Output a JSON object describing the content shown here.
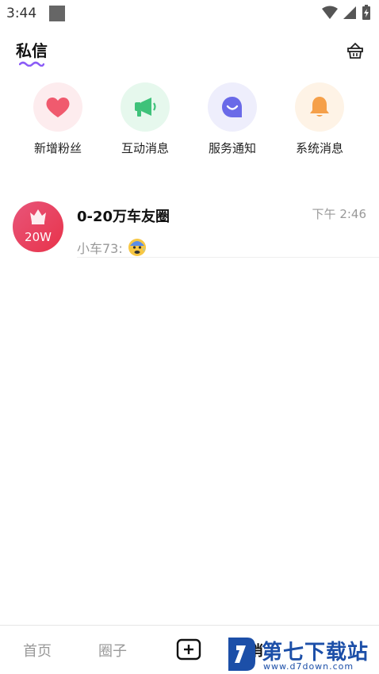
{
  "status_bar": {
    "time": "3:44"
  },
  "header": {
    "title": "私信"
  },
  "quick_actions": [
    {
      "label": "新增粉丝",
      "icon": "heart-icon",
      "color": "#f05a6e"
    },
    {
      "label": "互动消息",
      "icon": "megaphone-icon",
      "color": "#3fc27a"
    },
    {
      "label": "服务通知",
      "icon": "chat-smile-icon",
      "color": "#6a6ae8"
    },
    {
      "label": "系统消息",
      "icon": "bell-icon",
      "color": "#f5a04a"
    }
  ],
  "conversations": [
    {
      "name": "0-20万车友圈",
      "time": "下午 2:46",
      "preview": "小车73:",
      "avatar_badge": "20W",
      "emoji": "anxious-face-icon"
    }
  ],
  "tabbar": {
    "home": "首页",
    "circle": "圈子",
    "messages": "消"
  },
  "watermark": {
    "title": "第七下载站",
    "url": "www.d7down.com"
  }
}
